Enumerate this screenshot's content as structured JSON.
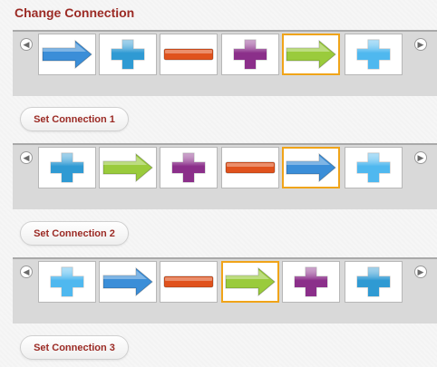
{
  "title": "Change Connection",
  "colors": {
    "accent": "#9b2a24",
    "selected_border": "#f0a419",
    "blue_arrow": "#3b8ed8",
    "green_arrow": "#9acb3c",
    "purple_cross": "#8b2f8a",
    "blue_cross": "#2f9ad3",
    "light_blue_cross": "#4fb8ef",
    "red_minus": "#e0521d"
  },
  "carousels": [
    {
      "button_label": "Set Connection 1",
      "selected_index": 4,
      "tiles": [
        "blue-arrow-icon",
        "blue-cross-icon",
        "red-minus-icon",
        "purple-cross-icon",
        "green-arrow-icon",
        "light-blue-cross-icon"
      ]
    },
    {
      "button_label": "Set Connection 2",
      "selected_index": 4,
      "tiles": [
        "blue-cross-icon",
        "green-arrow-icon",
        "purple-cross-icon",
        "red-minus-icon",
        "blue-arrow-icon",
        "light-blue-cross-icon"
      ]
    },
    {
      "button_label": "Set Connection 3",
      "selected_index": 3,
      "tiles": [
        "light-blue-cross-icon",
        "blue-arrow-icon",
        "red-minus-icon",
        "green-arrow-icon",
        "purple-cross-icon",
        "blue-cross-icon"
      ]
    }
  ]
}
